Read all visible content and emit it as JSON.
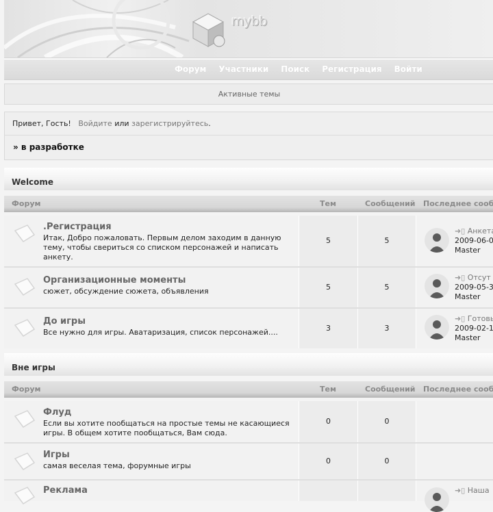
{
  "header": {
    "logo_text": "mybb"
  },
  "nav": {
    "items": [
      "Форум",
      "Участники",
      "Поиск",
      "Регистрация",
      "Войти"
    ]
  },
  "active_topics": "Активные темы",
  "greeting": {
    "hello": "Привет, Гость!",
    "login_link": "Войдите",
    "or": "или",
    "register_link": "зарегистрируйтесь",
    "dot": ".",
    "breadcrumb": "» в разработке"
  },
  "columns": {
    "forum": "Форум",
    "topics": "Тем",
    "posts": "Сообщений",
    "last_post": "Последнее сооб"
  },
  "categories": [
    {
      "title": "Welcome",
      "forums": [
        {
          "title": ".Регистрация",
          "desc": "Итак, Добро пожаловать. Первым делом заходим в данную тему, чтобы свериться со списком персонажей и написать анкету.",
          "topics": "5",
          "posts": "5",
          "last_topic": "Анкета",
          "last_date": "2009-06-0",
          "last_user": "Master"
        },
        {
          "title": "Организационные моменты",
          "desc": "сюжет, обсуждение сюжета, объявления",
          "topics": "5",
          "posts": "5",
          "last_topic": "Отсут",
          "last_date": "2009-05-3",
          "last_user": "Master"
        },
        {
          "title": "До игры",
          "desc": "Все нужно для игры. Аватаризация, список персонажей....",
          "topics": "3",
          "posts": "3",
          "last_topic": "Готовы",
          "last_date": "2009-02-1",
          "last_user": "Master"
        }
      ]
    },
    {
      "title": "Вне игры",
      "forums": [
        {
          "title": "Флуд",
          "desc": "Если вы хотите пообщаться на простые темы не касающиеся игры. В общем хотите пообщаться, Вам сюда.",
          "topics": "0",
          "posts": "0"
        },
        {
          "title": "Игры",
          "desc": "самая веселая тема, форумные игры",
          "topics": "0",
          "posts": "0"
        },
        {
          "title": "Реклама",
          "last_topic": "Наша"
        }
      ]
    }
  ],
  "colors": {
    "nav_text": "#ffffff",
    "link_gray": "#777777",
    "title_gray": "#666666"
  }
}
